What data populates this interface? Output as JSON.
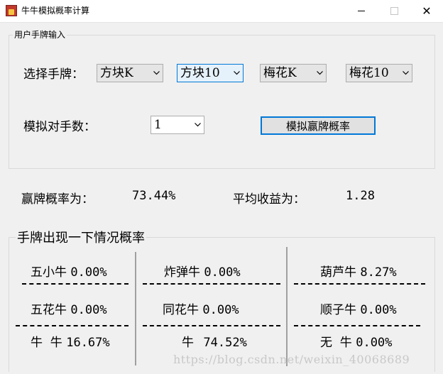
{
  "window": {
    "title": "牛牛模拟概率计算",
    "icon": "app-icon",
    "minimize_label": "minimize",
    "maximize_label": "maximize",
    "close_glyph": "✕"
  },
  "input_group": {
    "legend": "用户手牌输入",
    "select_label": "选择手牌：",
    "cards": [
      "方块K",
      "方块10",
      "梅花K",
      "梅花10"
    ],
    "opponents_label": "模拟对手数：",
    "opponents_value": "1",
    "simulate_button": "模拟赢牌概率"
  },
  "results": {
    "win_rate_label": "赢牌概率为：",
    "win_rate_value": "73.44%",
    "avg_gain_label": "平均收益为：",
    "avg_gain_value": "1.28"
  },
  "prob_group": {
    "legend": "手牌出现一下情况概率",
    "col1": [
      {
        "name": "五小牛",
        "value": "0.00%"
      },
      {
        "name": "五花牛",
        "value": "0.00%"
      },
      {
        "name": "牛  牛",
        "value": "16.67%"
      }
    ],
    "col2": [
      {
        "name": "炸弹牛",
        "value": "0.00%"
      },
      {
        "name": "同花牛",
        "value": "0.00%"
      },
      {
        "name": "牛",
        "value": "74.52%"
      }
    ],
    "col3": [
      {
        "name": "葫芦牛",
        "value": "8.27%"
      },
      {
        "name": "顺子牛",
        "value": "0.00%"
      },
      {
        "name": "无  牛",
        "value": "0.00%"
      }
    ]
  },
  "watermark": "https://blog.csdn.net/weixin_40068689"
}
